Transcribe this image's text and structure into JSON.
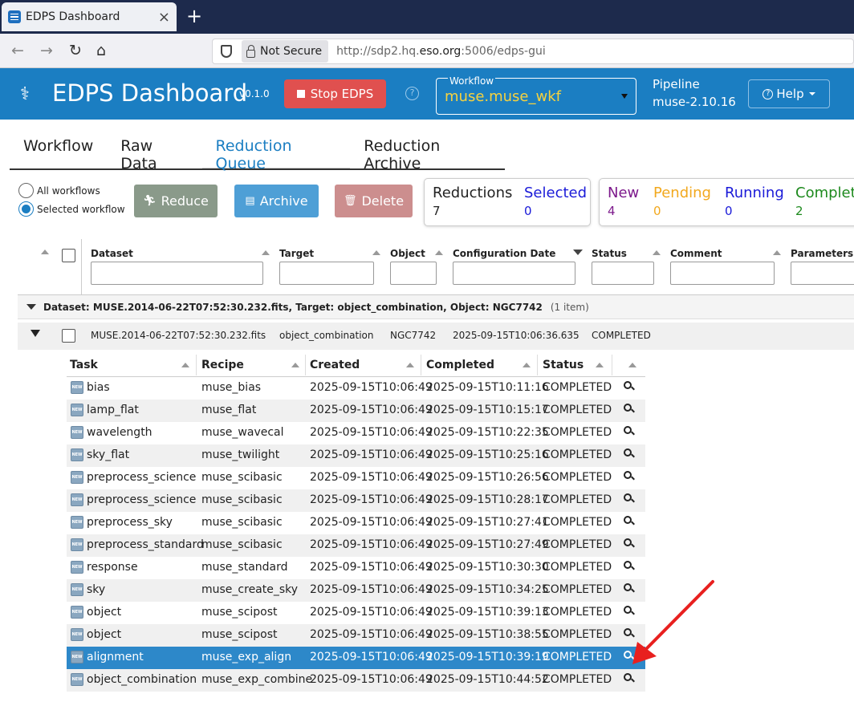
{
  "browser": {
    "tab_title": "EDPS Dashboard",
    "security_label": "Not Secure",
    "url_prefix": "http://sdp2.hq.",
    "url_domain": "eso.org",
    "url_suffix": ":5006/edps-gui"
  },
  "header": {
    "title": "EDPS Dashboard",
    "version": "v0.1.0",
    "stop_label": "Stop EDPS",
    "workflow_label": "Workflow",
    "workflow_value": "muse.muse_wkf",
    "pipeline_label": "Pipeline",
    "pipeline_value": "muse-2.10.16",
    "help_label": "Help"
  },
  "tabs": [
    "Workflow",
    "Raw Data",
    "Reduction Queue",
    "Reduction Archive"
  ],
  "controls": {
    "radio_all": "All workflows",
    "radio_selected": "Selected workflow",
    "reduce": "Reduce",
    "archive": "Archive",
    "delete": "Delete"
  },
  "stats": {
    "reductions_label": "Reductions",
    "reductions_value": "7",
    "selected_label": "Selected",
    "selected_value": "0",
    "new_label": "New",
    "new_value": "4",
    "pending_label": "Pending",
    "pending_value": "0",
    "running_label": "Running",
    "running_value": "0",
    "completed_label": "Complet",
    "completed_value": "2"
  },
  "grid": {
    "columns": [
      "Dataset",
      "Target",
      "Object",
      "Configuration Date",
      "Status",
      "Comment",
      "Parameters"
    ],
    "group_label": "Dataset: MUSE.2014-06-22T07:52:30.232.fits, Target: object_combination, Object: NGC7742",
    "group_count": "(1 item)",
    "row": {
      "dataset": "MUSE.2014-06-22T07:52:30.232.fits",
      "target": "object_combination",
      "object": "NGC7742",
      "date": "2025-09-15T10:06:36.635",
      "status": "COMPLETED"
    }
  },
  "subtable": {
    "columns": [
      "Task",
      "Recipe",
      "Created",
      "Completed",
      "Status"
    ],
    "rows": [
      {
        "task": "bias",
        "recipe": "muse_bias",
        "created": "2025-09-15T10:06:49",
        "completed": "2025-09-15T10:11:16",
        "status": "COMPLETED"
      },
      {
        "task": "lamp_flat",
        "recipe": "muse_flat",
        "created": "2025-09-15T10:06:49",
        "completed": "2025-09-15T10:15:17",
        "status": "COMPLETED"
      },
      {
        "task": "wavelength",
        "recipe": "muse_wavecal",
        "created": "2025-09-15T10:06:49",
        "completed": "2025-09-15T10:22:35",
        "status": "COMPLETED"
      },
      {
        "task": "sky_flat",
        "recipe": "muse_twilight",
        "created": "2025-09-15T10:06:49",
        "completed": "2025-09-15T10:25:16",
        "status": "COMPLETED"
      },
      {
        "task": "preprocess_science",
        "recipe": "muse_scibasic",
        "created": "2025-09-15T10:06:49",
        "completed": "2025-09-15T10:26:56",
        "status": "COMPLETED"
      },
      {
        "task": "preprocess_science",
        "recipe": "muse_scibasic",
        "created": "2025-09-15T10:06:49",
        "completed": "2025-09-15T10:28:17",
        "status": "COMPLETED"
      },
      {
        "task": "preprocess_sky",
        "recipe": "muse_scibasic",
        "created": "2025-09-15T10:06:49",
        "completed": "2025-09-15T10:27:41",
        "status": "COMPLETED"
      },
      {
        "task": "preprocess_standard",
        "recipe": "muse_scibasic",
        "created": "2025-09-15T10:06:49",
        "completed": "2025-09-15T10:27:49",
        "status": "COMPLETED"
      },
      {
        "task": "response",
        "recipe": "muse_standard",
        "created": "2025-09-15T10:06:49",
        "completed": "2025-09-15T10:30:30",
        "status": "COMPLETED"
      },
      {
        "task": "sky",
        "recipe": "muse_create_sky",
        "created": "2025-09-15T10:06:49",
        "completed": "2025-09-15T10:34:25",
        "status": "COMPLETED"
      },
      {
        "task": "object",
        "recipe": "muse_scipost",
        "created": "2025-09-15T10:06:49",
        "completed": "2025-09-15T10:39:13",
        "status": "COMPLETED"
      },
      {
        "task": "object",
        "recipe": "muse_scipost",
        "created": "2025-09-15T10:06:49",
        "completed": "2025-09-15T10:38:55",
        "status": "COMPLETED"
      },
      {
        "task": "alignment",
        "recipe": "muse_exp_align",
        "created": "2025-09-15T10:06:49",
        "completed": "2025-09-15T10:39:19",
        "status": "COMPLETED"
      },
      {
        "task": "object_combination",
        "recipe": "muse_exp_combine",
        "created": "2025-09-15T10:06:49",
        "completed": "2025-09-15T10:44:52",
        "status": "COMPLETED"
      }
    ]
  },
  "colors": {
    "header_bg": "#1b7ec2",
    "stop_red": "#e0504f",
    "workflow_yellow": "#f7d23e",
    "new": "#7d1a8c",
    "pending": "#f2a81d",
    "running": "#1a1ad8",
    "completed": "#1e8a1e",
    "selected_row": "#2d88c9",
    "annotation_arrow": "#e8201f"
  }
}
